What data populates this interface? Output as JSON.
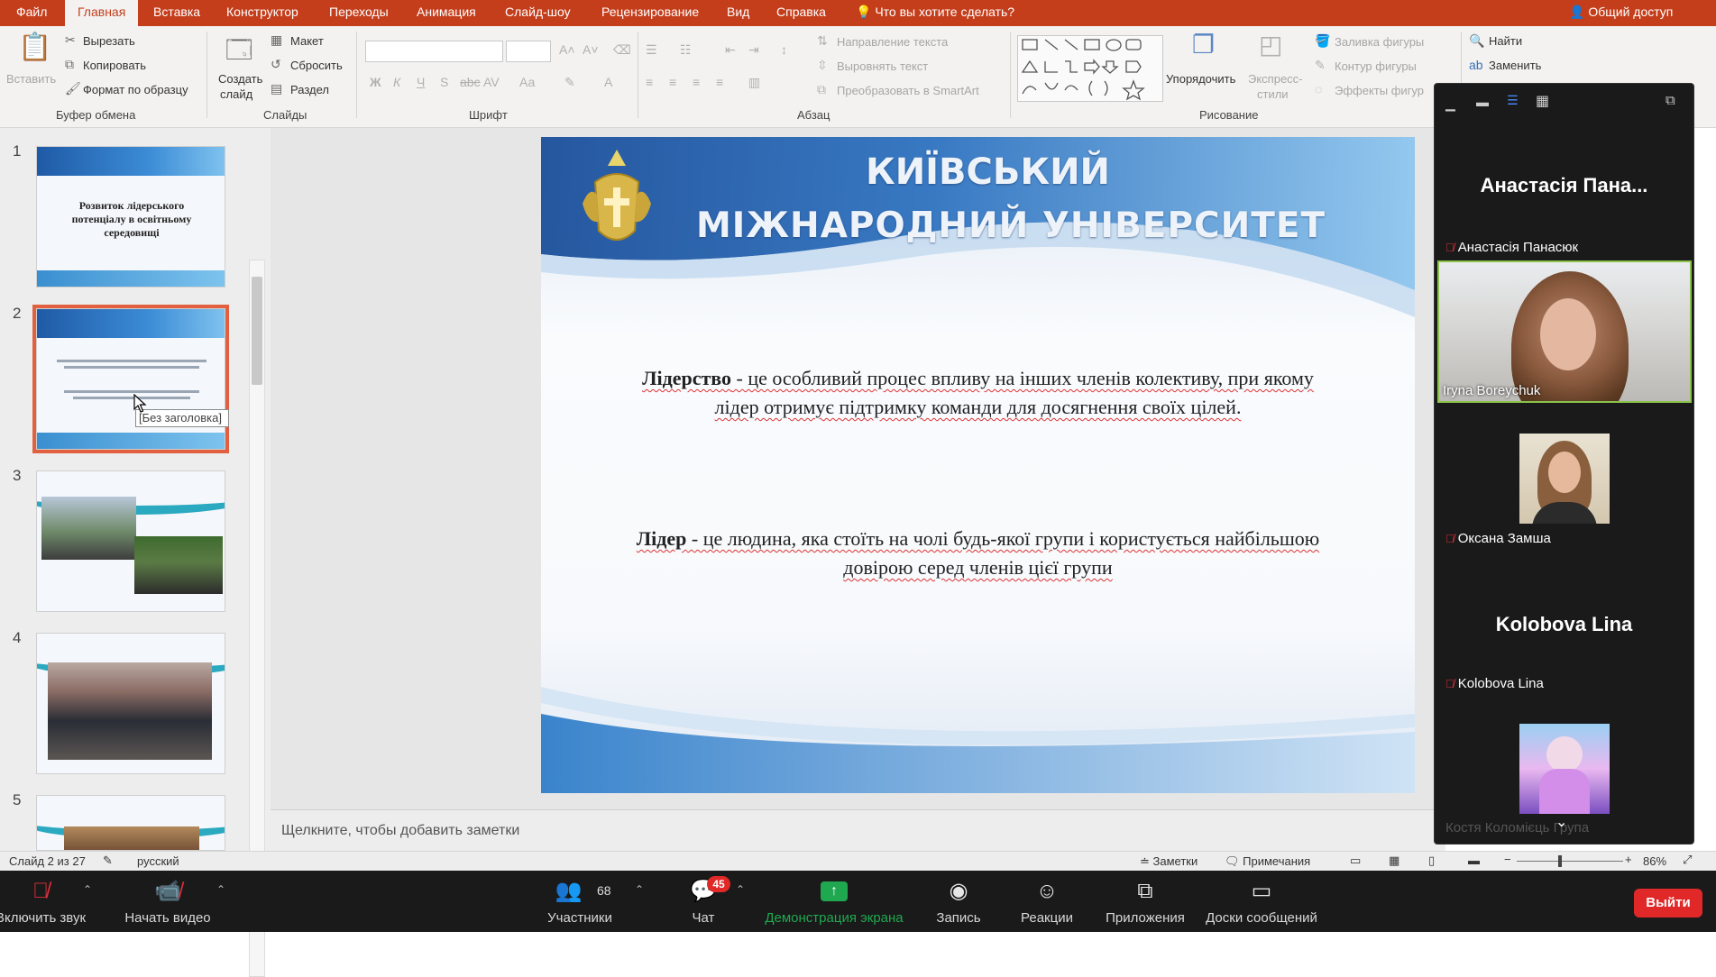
{
  "menubar": {
    "tabs": [
      {
        "label": "Файл",
        "active": false
      },
      {
        "label": "Главная",
        "active": true
      },
      {
        "label": "Вставка",
        "active": false
      },
      {
        "label": "Конструктор",
        "active": false
      },
      {
        "label": "Переходы",
        "active": false
      },
      {
        "label": "Анимация",
        "active": false
      },
      {
        "label": "Слайд-шоу",
        "active": false
      },
      {
        "label": "Рецензирование",
        "active": false
      },
      {
        "label": "Вид",
        "active": false
      },
      {
        "label": "Справка",
        "active": false
      }
    ],
    "tell_me": "Что вы хотите сделать?",
    "share": "Общий доступ"
  },
  "ribbon": {
    "clipboard": {
      "paste": "Вставить",
      "cut": "Вырезать",
      "copy": "Копировать",
      "format_painter": "Формат по образцу",
      "group": "Буфер обмена"
    },
    "slides": {
      "new_slide_line1": "Создать",
      "new_slide_line2": "слайд",
      "layout": "Макет",
      "reset": "Сбросить",
      "section": "Раздел",
      "group": "Слайды"
    },
    "font": {
      "group": "Шрифт",
      "bold": "Ж",
      "italic": "К",
      "underline": "Ч",
      "strike": "S",
      "abc": "abc",
      "aa": "Аа"
    },
    "paragraph": {
      "text_direction": "Направление текста",
      "align_text": "Выровнять текст",
      "smartart": "Преобразовать в SmartArt",
      "group": "Абзац"
    },
    "drawing": {
      "arrange": "Упорядочить",
      "quick_styles_line1": "Экспресс-",
      "quick_styles_line2": "стили",
      "shape_fill": "Заливка фигуры",
      "shape_outline": "Контур фигуры",
      "shape_effects": "Эффекты фигур",
      "group": "Рисование"
    },
    "editing": {
      "find": "Найти",
      "replace": "Заменить"
    }
  },
  "thumbnails": {
    "numbers": [
      "1",
      "2",
      "3",
      "4",
      "5"
    ],
    "selected": "2",
    "slide1_title": "Розвиток лідерського потенціалу в освітньому середовищі",
    "tooltip": "[Без заголовка]"
  },
  "slide": {
    "title_line1": "КИЇВСЬКИЙ",
    "title_line2": "МІЖНАРОДНИЙ УНІВЕРСИТЕТ",
    "para1_term": "Лідерство",
    "para1_text": " - це особливий процес впливу на інших членів колективу, при якому лідер отримує підтримку команди для досягнення своїх цілей.",
    "para2_term": "Лідер",
    "para2_text": " - це людина, яка стоїть на чолі будь-якої групи і користується найбільшою довірою серед членів цієї групи"
  },
  "notes": {
    "placeholder": "Щелкните, чтобы добавить заметки"
  },
  "statusbar": {
    "slide_info": "Слайд 2 из 27",
    "language": "русский",
    "notes_btn": "Заметки",
    "comments_btn": "Примечания",
    "zoom": "86%"
  },
  "gallery": {
    "tiles": [
      {
        "big_name": "Анастасія Пана...",
        "label": "Анастасія Панасюк",
        "muted": true
      },
      {
        "label": "Iryna Boreychuk",
        "muted": false
      },
      {
        "label": "Оксана Замша",
        "muted": true
      },
      {
        "big_name": "Kolobova Lina",
        "label": "Kolobova Lina",
        "muted": true
      }
    ],
    "partial_label": "Костя Коломієць Група"
  },
  "zoombar": {
    "unmute": "Включить звук",
    "start_video": "Начать видео",
    "participants": "Участники",
    "participants_count": "68",
    "chat": "Чат",
    "chat_badge": "45",
    "share_screen": "Демонстрация экрана",
    "record": "Запись",
    "reactions": "Реакции",
    "apps": "Приложения",
    "whiteboards": "Доски сообщений",
    "leave": "Выйти"
  },
  "colors": {
    "ppt_accent": "#c43e1c",
    "zoom_share_green": "#1fa84f",
    "leave_red": "#e02828",
    "badge_red": "#e02828"
  }
}
